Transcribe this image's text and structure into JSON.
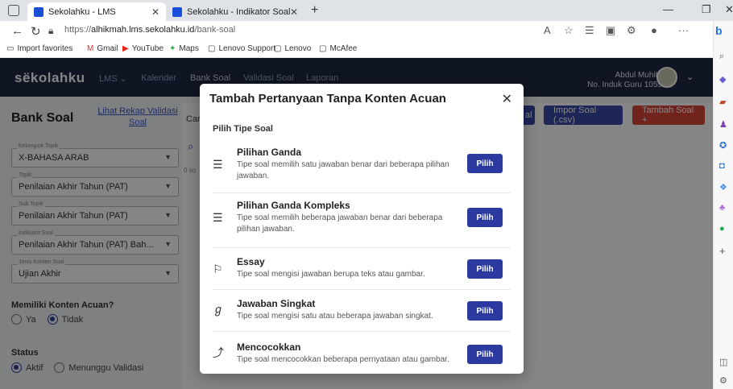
{
  "browser": {
    "tabs": [
      {
        "label": "Sekolahku - LMS"
      },
      {
        "label": "Sekolahku - Indikator Soal"
      }
    ],
    "url_prefix": "https://",
    "url_host": "alhikmah.lms.sekolahku.id",
    "url_path": "/bank-soal",
    "favorites": [
      "Import favorites",
      "Gmail",
      "YouTube",
      "Maps",
      "Lenovo Support",
      "Lenovo",
      "McAfee"
    ]
  },
  "header": {
    "brand": "sëkolahku",
    "nav": [
      "LMS ⌄",
      "Kalender",
      "Bank Soal",
      "Validasi Soal",
      "Laporan"
    ],
    "user_name": "Abdul Muhith",
    "user_id": "No. Induk Guru 1055"
  },
  "page": {
    "title": "Bank Soal",
    "rekap_link": "Lihat Rekap Validasi Soal",
    "filters": [
      {
        "label": "Kelompok Topik",
        "value": "X-BAHASA ARAB"
      },
      {
        "label": "Topik",
        "value": "Penilaian Akhir Tahun (PAT)"
      },
      {
        "label": "Sub Topik",
        "value": "Penilaian Akhir Tahun (PAT)"
      },
      {
        "label": "Indikator Soal",
        "value": "Penilaian Akhir Tahun (PAT) Bah..."
      },
      {
        "label": "Jenis Konten Soal",
        "value": "Ujian Akhir"
      }
    ],
    "konten_acuan_label": "Memiliki Konten Acuan?",
    "konten_acuan_options": [
      "Ya",
      "Tidak"
    ],
    "status_label": "Status",
    "status_options": [
      "Aktif",
      "Menunggu Validasi"
    ],
    "search_fragment": "Car",
    "count_fragment": "0 so",
    "buttons": {
      "impor": "Impor Soal (.csv)",
      "tambah": "Tambah Soal +",
      "partial": "al"
    }
  },
  "modal": {
    "title": "Tambah Pertanyaan Tanpa Konten Acuan",
    "subtitle": "Pilih Tipe Soal",
    "button_label": "Pilih",
    "options": [
      {
        "title": "Pilihan Ganda",
        "desc": "Tipe soal memilih satu jawaban benar dari beberapa pilihan jawaban.",
        "icon": "list-icon"
      },
      {
        "title": "Pilihan Ganda Kompleks",
        "desc": "Tipe soal memilih beberapa jawaban benar dari beberapa pilihan jawaban.",
        "icon": "list-icon"
      },
      {
        "title": "Essay",
        "desc": "Tipe soal mengisi jawaban berupa teks atau gambar.",
        "icon": "flag-icon"
      },
      {
        "title": "Jawaban Singkat",
        "desc": "Tipe soal mengisi satu atau beberapa jawaban singkat.",
        "icon": "short-answer-icon"
      },
      {
        "title": "Mencocokkan",
        "desc": "Tipe soal mencocokkan beberapa pernyataan atau gambar.",
        "icon": "match-icon"
      }
    ]
  },
  "colors": {
    "primary": "#2c3aa0",
    "header_bg": "#1f2a44",
    "danger": "#d9453b",
    "impor": "#3b4aa8"
  }
}
